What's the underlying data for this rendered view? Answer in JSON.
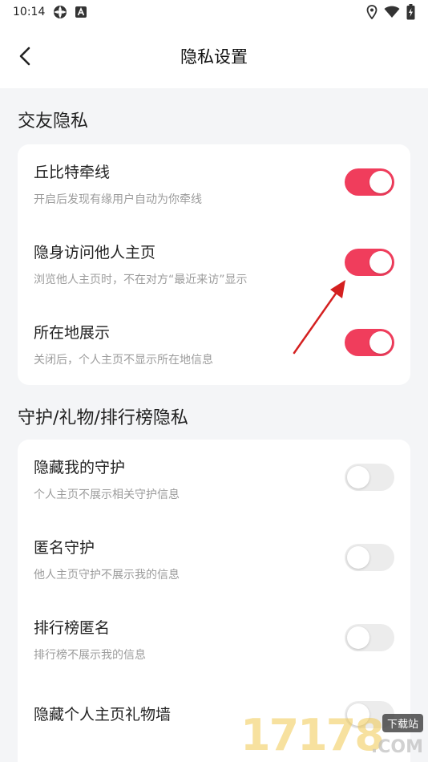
{
  "status_bar": {
    "time": "10:14",
    "icons_left": [
      "app-notification-icon",
      "a-letter-icon"
    ],
    "icons_right": [
      "location-icon",
      "wifi-icon",
      "battery-charging-icon"
    ]
  },
  "header": {
    "title": "隐私设置",
    "back_icon": "chevron-left-icon"
  },
  "sections": [
    {
      "title": "交友隐私",
      "items": [
        {
          "title": "丘比特牵线",
          "desc": "开启后发现有缘用户自动为你牵线",
          "enabled": true
        },
        {
          "title": "隐身访问他人主页",
          "desc": "浏览他人主页时，不在对方“最近来访”显示",
          "enabled": true
        },
        {
          "title": "所在地展示",
          "desc": "关闭后，个人主页不显示所在地信息",
          "enabled": true
        }
      ]
    },
    {
      "title": "守护/礼物/排行榜隐私",
      "items": [
        {
          "title": "隐藏我的守护",
          "desc": "个人主页不展示相关守护信息",
          "enabled": false
        },
        {
          "title": "匿名守护",
          "desc": "他人主页守护不展示我的信息",
          "enabled": false
        },
        {
          "title": "排行榜匿名",
          "desc": "排行榜不展示我的信息",
          "enabled": false
        },
        {
          "title": "隐藏个人主页礼物墙",
          "desc": "",
          "enabled": false
        }
      ]
    }
  ],
  "watermark": {
    "digits": "17178",
    "domain": ".COM",
    "site_label": "下载站"
  },
  "colors": {
    "accent": "#f03d5c",
    "toggle_off": "#ececec",
    "background": "#f4f5f7",
    "annotation_arrow": "#d42020"
  }
}
